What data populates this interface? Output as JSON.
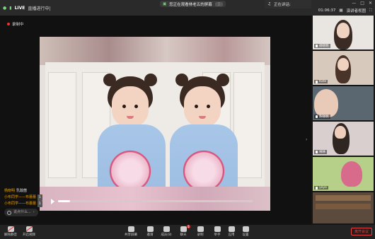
{
  "topbar": {
    "live_label": "LIVE",
    "live_status": "直播进行中|",
    "share_notice": "您正在观看林老五的屏幕",
    "share_stop": "",
    "host_label": "正在讲话:",
    "timer": "01:06:37",
    "view_label": "演讲者视图"
  },
  "stage": {
    "recording_label": "录制中",
    "playback_progress": 0.06
  },
  "chat": {
    "messages": [
      {
        "name": "杨晓明",
        "sep": "",
        "msg": "乳酸菌",
        "tag": ""
      },
      {
        "name": "小布同学——布蕾蕾",
        "sep": "",
        "msg": "",
        "tag": "1"
      },
      {
        "name": "小布同学——布蕾蕾",
        "sep": "",
        "msg": "",
        "tag": "1"
      }
    ],
    "input_placeholder": "说点什么..."
  },
  "participants": [
    {
      "label": "杨晓明",
      "mic": "on",
      "bg": "#e9e6e2"
    },
    {
      "label": "Kate",
      "mic": "on",
      "bg": "#d7c9bb"
    },
    {
      "label": "陈晓明",
      "mic": "on",
      "bg": "#5a6670"
    },
    {
      "label": "林林",
      "mic": "on",
      "bg": "#d9cfcf"
    },
    {
      "label": "yoyo",
      "mic": "on",
      "bg": "#b6d08a"
    },
    {
      "label": "",
      "mic": "on",
      "bg": "#5c4a3c"
    }
  ],
  "toolbar": {
    "items": [
      {
        "label": "解除静音",
        "icon": "mic-muted-icon",
        "red": true
      },
      {
        "label": "开启视频",
        "icon": "video-off-icon",
        "red": true
      },
      {
        "label": "共享屏幕",
        "icon": "share-screen-icon",
        "red": false
      },
      {
        "label": "邀请",
        "icon": "invite-icon",
        "red": false
      },
      {
        "label": "成员(8)",
        "icon": "members-icon",
        "red": false
      },
      {
        "label": "聊天",
        "icon": "chat-icon",
        "red": false,
        "badge": "1"
      },
      {
        "label": "录制",
        "icon": "record-icon",
        "red": false
      },
      {
        "label": "举手",
        "icon": "raise-hand-icon",
        "red": false
      },
      {
        "label": "应用",
        "icon": "apps-icon",
        "red": false
      },
      {
        "label": "设置",
        "icon": "settings-icon",
        "red": false
      }
    ],
    "leave_label": "离开会议"
  },
  "colors": {
    "leave": "#e44444",
    "live": "#ffffff",
    "chat_name": "#f0a000"
  }
}
